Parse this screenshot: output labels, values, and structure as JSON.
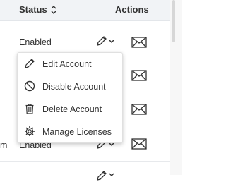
{
  "table": {
    "columns": {
      "status": "Status",
      "actions": "Actions"
    },
    "rows": [
      {
        "status": "Enabled"
      },
      {
        "status": ""
      },
      {
        "status": ""
      },
      {
        "status": "Enabled",
        "cut_prefix": "m"
      }
    ]
  },
  "action_menu": {
    "items": [
      {
        "label": "Edit Account",
        "icon": "pencil-icon"
      },
      {
        "label": "Disable Account",
        "icon": "ban-icon"
      },
      {
        "label": "Delete Account",
        "icon": "trash-icon"
      },
      {
        "label": "Manage Licenses",
        "icon": "gear-icon"
      }
    ]
  },
  "colors": {
    "header_bg": "#f1f3f6",
    "text": "#333333",
    "icon": "#333333",
    "border": "#e7e9ec"
  }
}
